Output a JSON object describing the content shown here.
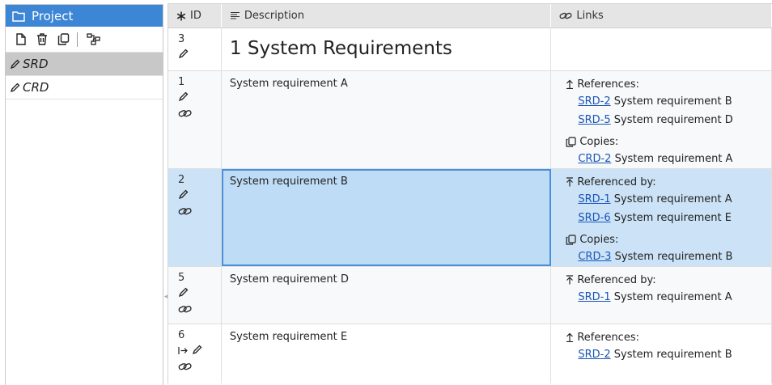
{
  "sidebar": {
    "title": "Project",
    "documents": [
      {
        "label": "SRD",
        "active": true
      },
      {
        "label": "CRD",
        "active": false
      }
    ]
  },
  "table": {
    "columns": {
      "id": "ID",
      "description": "Description",
      "links": "Links"
    },
    "rows": [
      {
        "id": "3",
        "description": "1 System Requirements"
      },
      {
        "id": "1",
        "description": "System requirement A",
        "links": {
          "g1_label": "References:",
          "g1_l1_code": "SRD-2",
          "g1_l1_text": "System requirement B",
          "g1_l2_code": "SRD-5",
          "g1_l2_text": "System requirement D",
          "g2_label": "Copies:",
          "g2_l1_code": "CRD-2",
          "g2_l1_text": "System requirement A"
        }
      },
      {
        "id": "2",
        "description": "System requirement B",
        "links": {
          "g1_label": "Referenced by:",
          "g1_l1_code": "SRD-1",
          "g1_l1_text": "System requirement A",
          "g1_l2_code": "SRD-6",
          "g1_l2_text": "System requirement E",
          "g2_label": "Copies:",
          "g2_l1_code": "CRD-3",
          "g2_l1_text": "System requirement B"
        }
      },
      {
        "id": "5",
        "description": "System requirement D",
        "links": {
          "g1_label": "Referenced by:",
          "g1_l1_code": "SRD-1",
          "g1_l1_text": "System requirement A"
        }
      },
      {
        "id": "6",
        "description": "System requirement E",
        "links": {
          "g1_label": "References:",
          "g1_l1_code": "SRD-2",
          "g1_l1_text": "System requirement B"
        }
      }
    ]
  },
  "colors": {
    "accent": "#3d86d6",
    "selected_row": "#cce3f7",
    "link": "#1a55b8"
  }
}
